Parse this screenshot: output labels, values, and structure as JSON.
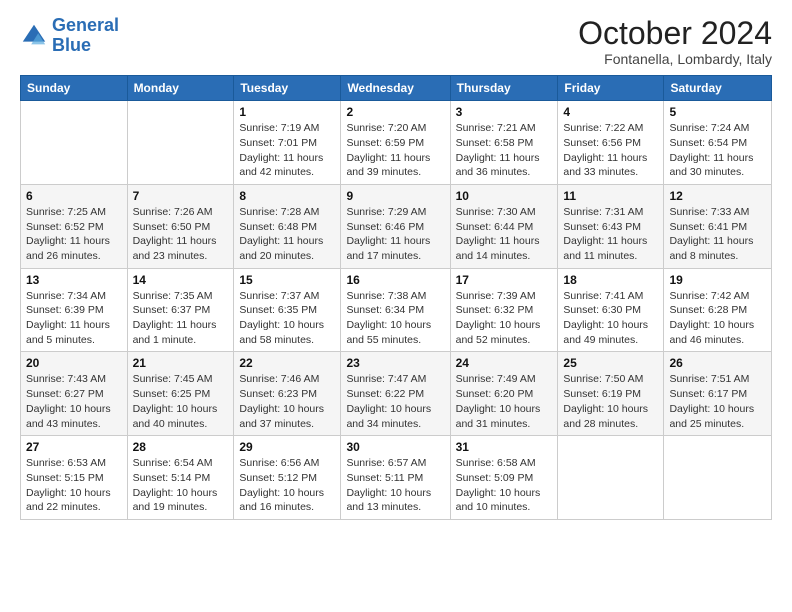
{
  "logo": {
    "line1": "General",
    "line2": "Blue"
  },
  "title": "October 2024",
  "location": "Fontanella, Lombardy, Italy",
  "days_header": [
    "Sunday",
    "Monday",
    "Tuesday",
    "Wednesday",
    "Thursday",
    "Friday",
    "Saturday"
  ],
  "weeks": [
    [
      {
        "day": "",
        "detail": ""
      },
      {
        "day": "",
        "detail": ""
      },
      {
        "day": "1",
        "detail": "Sunrise: 7:19 AM\nSunset: 7:01 PM\nDaylight: 11 hours and 42 minutes."
      },
      {
        "day": "2",
        "detail": "Sunrise: 7:20 AM\nSunset: 6:59 PM\nDaylight: 11 hours and 39 minutes."
      },
      {
        "day": "3",
        "detail": "Sunrise: 7:21 AM\nSunset: 6:58 PM\nDaylight: 11 hours and 36 minutes."
      },
      {
        "day": "4",
        "detail": "Sunrise: 7:22 AM\nSunset: 6:56 PM\nDaylight: 11 hours and 33 minutes."
      },
      {
        "day": "5",
        "detail": "Sunrise: 7:24 AM\nSunset: 6:54 PM\nDaylight: 11 hours and 30 minutes."
      }
    ],
    [
      {
        "day": "6",
        "detail": "Sunrise: 7:25 AM\nSunset: 6:52 PM\nDaylight: 11 hours and 26 minutes."
      },
      {
        "day": "7",
        "detail": "Sunrise: 7:26 AM\nSunset: 6:50 PM\nDaylight: 11 hours and 23 minutes."
      },
      {
        "day": "8",
        "detail": "Sunrise: 7:28 AM\nSunset: 6:48 PM\nDaylight: 11 hours and 20 minutes."
      },
      {
        "day": "9",
        "detail": "Sunrise: 7:29 AM\nSunset: 6:46 PM\nDaylight: 11 hours and 17 minutes."
      },
      {
        "day": "10",
        "detail": "Sunrise: 7:30 AM\nSunset: 6:44 PM\nDaylight: 11 hours and 14 minutes."
      },
      {
        "day": "11",
        "detail": "Sunrise: 7:31 AM\nSunset: 6:43 PM\nDaylight: 11 hours and 11 minutes."
      },
      {
        "day": "12",
        "detail": "Sunrise: 7:33 AM\nSunset: 6:41 PM\nDaylight: 11 hours and 8 minutes."
      }
    ],
    [
      {
        "day": "13",
        "detail": "Sunrise: 7:34 AM\nSunset: 6:39 PM\nDaylight: 11 hours and 5 minutes."
      },
      {
        "day": "14",
        "detail": "Sunrise: 7:35 AM\nSunset: 6:37 PM\nDaylight: 11 hours and 1 minute."
      },
      {
        "day": "15",
        "detail": "Sunrise: 7:37 AM\nSunset: 6:35 PM\nDaylight: 10 hours and 58 minutes."
      },
      {
        "day": "16",
        "detail": "Sunrise: 7:38 AM\nSunset: 6:34 PM\nDaylight: 10 hours and 55 minutes."
      },
      {
        "day": "17",
        "detail": "Sunrise: 7:39 AM\nSunset: 6:32 PM\nDaylight: 10 hours and 52 minutes."
      },
      {
        "day": "18",
        "detail": "Sunrise: 7:41 AM\nSunset: 6:30 PM\nDaylight: 10 hours and 49 minutes."
      },
      {
        "day": "19",
        "detail": "Sunrise: 7:42 AM\nSunset: 6:28 PM\nDaylight: 10 hours and 46 minutes."
      }
    ],
    [
      {
        "day": "20",
        "detail": "Sunrise: 7:43 AM\nSunset: 6:27 PM\nDaylight: 10 hours and 43 minutes."
      },
      {
        "day": "21",
        "detail": "Sunrise: 7:45 AM\nSunset: 6:25 PM\nDaylight: 10 hours and 40 minutes."
      },
      {
        "day": "22",
        "detail": "Sunrise: 7:46 AM\nSunset: 6:23 PM\nDaylight: 10 hours and 37 minutes."
      },
      {
        "day": "23",
        "detail": "Sunrise: 7:47 AM\nSunset: 6:22 PM\nDaylight: 10 hours and 34 minutes."
      },
      {
        "day": "24",
        "detail": "Sunrise: 7:49 AM\nSunset: 6:20 PM\nDaylight: 10 hours and 31 minutes."
      },
      {
        "day": "25",
        "detail": "Sunrise: 7:50 AM\nSunset: 6:19 PM\nDaylight: 10 hours and 28 minutes."
      },
      {
        "day": "26",
        "detail": "Sunrise: 7:51 AM\nSunset: 6:17 PM\nDaylight: 10 hours and 25 minutes."
      }
    ],
    [
      {
        "day": "27",
        "detail": "Sunrise: 6:53 AM\nSunset: 5:15 PM\nDaylight: 10 hours and 22 minutes."
      },
      {
        "day": "28",
        "detail": "Sunrise: 6:54 AM\nSunset: 5:14 PM\nDaylight: 10 hours and 19 minutes."
      },
      {
        "day": "29",
        "detail": "Sunrise: 6:56 AM\nSunset: 5:12 PM\nDaylight: 10 hours and 16 minutes."
      },
      {
        "day": "30",
        "detail": "Sunrise: 6:57 AM\nSunset: 5:11 PM\nDaylight: 10 hours and 13 minutes."
      },
      {
        "day": "31",
        "detail": "Sunrise: 6:58 AM\nSunset: 5:09 PM\nDaylight: 10 hours and 10 minutes."
      },
      {
        "day": "",
        "detail": ""
      },
      {
        "day": "",
        "detail": ""
      }
    ]
  ]
}
